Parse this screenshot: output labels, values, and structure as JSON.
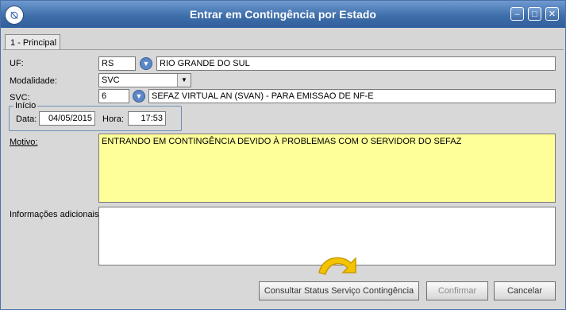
{
  "window": {
    "title": "Entrar em Contingência por Estado",
    "minimize": "–",
    "maximize": "□",
    "close": "✕"
  },
  "tabs": [
    {
      "label": "1 - Principal"
    }
  ],
  "form": {
    "uf_label": "UF:",
    "uf_code": "RS",
    "uf_name": "RIO GRANDE DO SUL",
    "modalidade_label": "Modalidade:",
    "modalidade_value": "SVC",
    "svc_label": "SVC:",
    "svc_code": "6",
    "svc_desc": "SEFAZ VIRTUAL AN (SVAN) - PARA EMISSAO DE NF-E",
    "inicio_label": "Início",
    "data_label": "Data:",
    "data_value": "04/05/2015",
    "hora_label": "Hora:",
    "hora_value": "17:53",
    "motivo_label": "Motivo:",
    "motivo_value": "ENTRANDO EM CONTINGÊNCIA DEVIDO À PROBLEMAS COM O SERVIDOR DO SEFAZ",
    "info_label": "Informações adicionais:",
    "info_value": ""
  },
  "buttons": {
    "consultar": "Consultar Status Serviço Contingência",
    "confirmar": "Confirmar",
    "cancelar": "Cancelar"
  },
  "colors": {
    "motivo_bg": "#ffff99",
    "titlebar": "#3f6fab"
  }
}
